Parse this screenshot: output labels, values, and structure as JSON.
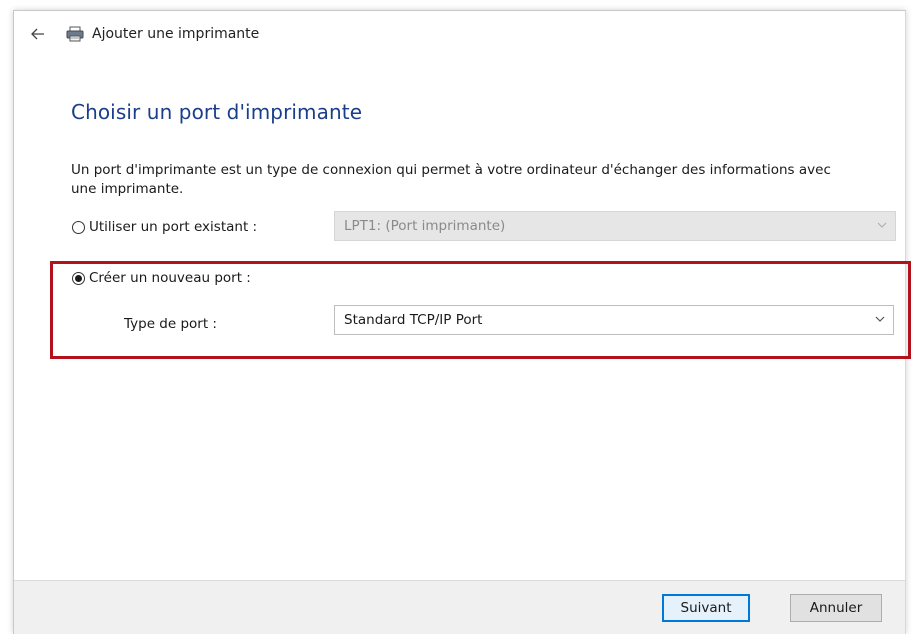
{
  "window": {
    "title": "Ajouter une imprimante"
  },
  "page": {
    "heading": "Choisir un port d'imprimante",
    "description": "Un port d'imprimante est un type de connexion qui permet à votre ordinateur d'échanger des informations avec une imprimante."
  },
  "options": {
    "existing": {
      "label": "Utiliser un port existant :",
      "selected": false,
      "value": "LPT1: (Port imprimante)"
    },
    "new": {
      "label": "Créer un nouveau port :",
      "selected": true,
      "type_label": "Type de port :",
      "value": "Standard TCP/IP Port"
    }
  },
  "footer": {
    "next_label": "Suivant",
    "cancel_label": "Annuler"
  },
  "colors": {
    "heading": "#1a3e8c",
    "highlight": "#b3121c",
    "primary_border": "#0078d7"
  },
  "icons": {
    "back": "arrow-left-icon",
    "printer": "printer-icon",
    "dropdown": "chevron-down-icon"
  }
}
